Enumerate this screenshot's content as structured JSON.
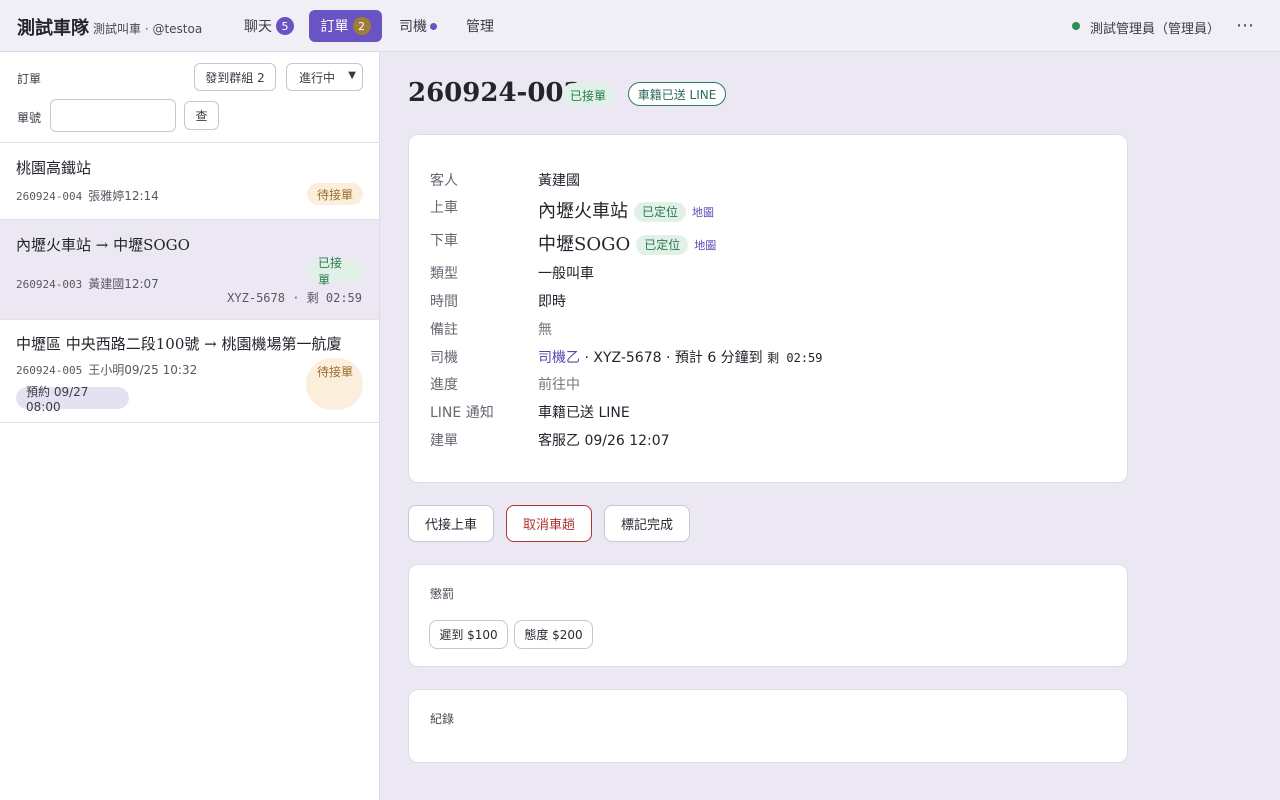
{
  "header": {
    "brand": "測試車隊",
    "subtitle": "測試叫車 · @testoa",
    "nav": {
      "chat": "聊天",
      "chat_count": "5",
      "orders": "訂單",
      "orders_count": "2",
      "drivers": "司機",
      "admin": "管理"
    },
    "user": "測試管理員（管理員）",
    "more": "⋯",
    "status_color": "#2a8d5a"
  },
  "sidebar": {
    "orders_label": "訂單",
    "send_group_button": "發到群組 2",
    "status_filter": "進行中",
    "order_no_label": "單號",
    "order_no_value": "",
    "search_button": "查",
    "orders": [
      {
        "title": "桃園高鐵站",
        "id": "260924-004",
        "customer_time": "張雅婷12:14",
        "status": "待接單"
      },
      {
        "title": "內壢火車站 → 中壢SOGO",
        "id": "260924-003",
        "customer_time": "黃建國12:07",
        "status": "已接單",
        "vehicle": "XYZ-5678 · 剩 02:59"
      },
      {
        "title": "中壢區 中央西路二段100號 → 桃園機場第一航廈",
        "id": "260924-005",
        "customer_time": "王小明09/25 10:32",
        "status": "待接單",
        "reservation": "預約 09/27 08:00"
      }
    ]
  },
  "detail": {
    "order_no": "260924-003",
    "status_tag": "已接單",
    "line_tag": "車籍已送 LINE",
    "fields": {
      "customer_label": "客人",
      "customer": "黃建國",
      "pickup_label": "上車",
      "pickup": "內壢火車站",
      "pickup_located": "已定位",
      "pickup_map": "地圖",
      "dropoff_label": "下車",
      "dropoff": "中壢SOGO",
      "dropoff_located": "已定位",
      "dropoff_map": "地圖",
      "type_label": "類型",
      "type": "一般叫車",
      "time_label": "時間",
      "time": "即時",
      "note_label": "備註",
      "note": "無",
      "driver_label": "司機",
      "driver_name": "司機乙",
      "driver_info": " · XYZ-5678 · 預計 6 分鐘到 ",
      "driver_remaining": "剩 02:59",
      "progress_label": "進度",
      "progress": "前往中",
      "line_label": "LINE 通知",
      "line": "車籍已送 LINE",
      "created_label": "建單",
      "created": "客服乙 09/26 12:07"
    },
    "actions": {
      "pickup_proxy": "代接上車",
      "cancel": "取消車趟",
      "complete": "標記完成"
    },
    "penalty": {
      "title": "懲罰",
      "late": "遲到 $100",
      "attitude": "態度 $200"
    },
    "log": {
      "title": "紀錄"
    }
  },
  "colors": {
    "accent": "#6a53c3",
    "accepted": "#2a7a4f",
    "pending": "#9a6d2a",
    "danger": "#b2332f"
  }
}
